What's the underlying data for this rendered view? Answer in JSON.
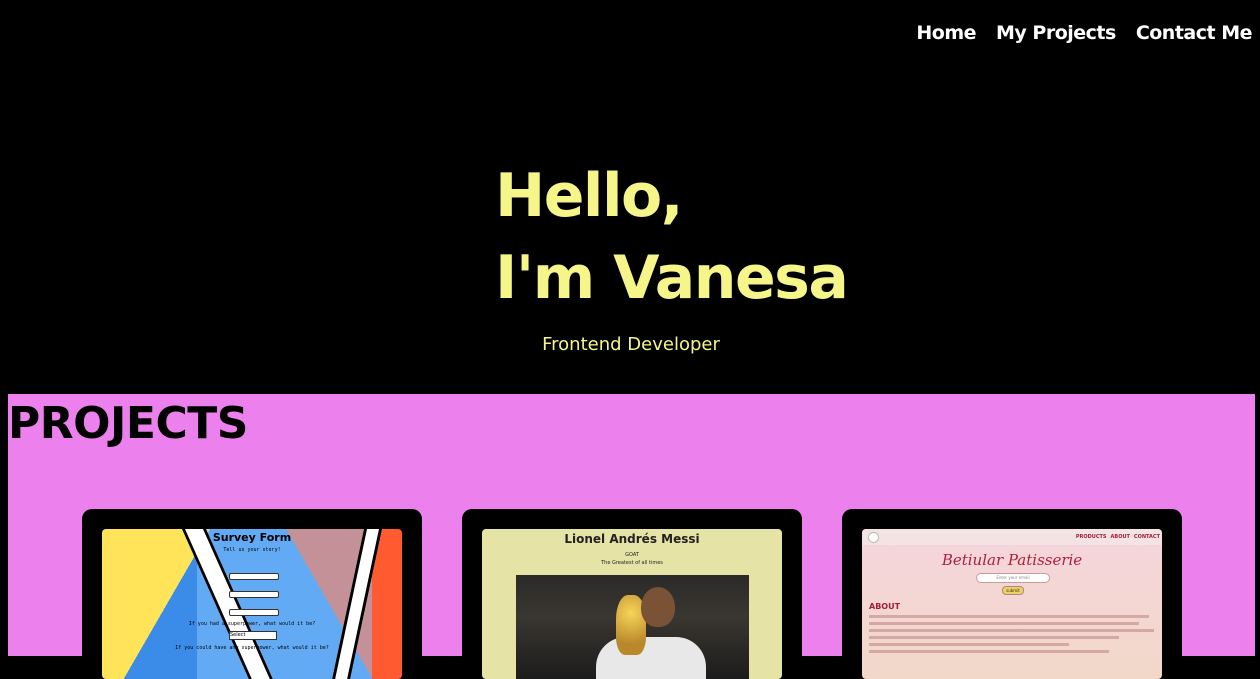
{
  "nav": {
    "items": [
      "Home",
      "My Projects",
      "Contact Me"
    ]
  },
  "hero": {
    "greeting_line1": "Hello,",
    "greeting_line2": "I'm Vanesa",
    "subtitle": "Frontend Developer"
  },
  "projects": {
    "heading": "PROJECTS",
    "cards": [
      {
        "title": "Survey Form",
        "subtitle": "Tell us your story!",
        "question1": "If you had a superpower, what would it be?",
        "select_value": "Select",
        "question2": "If you could have any superpower, what would it be?"
      },
      {
        "title": "Lionel Andrés Messi",
        "line1": "GOAT",
        "line2": "The Greatest of all times"
      },
      {
        "brand": "Betiular Patisserie",
        "nav": [
          "PRODUCTS",
          "ABOUT",
          "CONTACT"
        ],
        "email_placeholder": "Enter your email",
        "submit_label": "submit",
        "about_heading": "ABOUT"
      }
    ]
  },
  "colors": {
    "hero_text": "#f5f58a",
    "projects_bg": "#ec80ec",
    "page_bg": "#000000"
  }
}
